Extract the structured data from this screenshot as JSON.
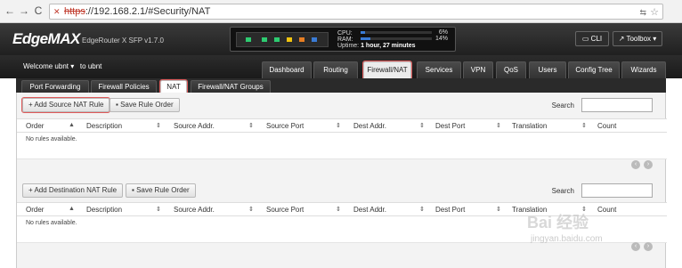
{
  "browser": {
    "back": "←",
    "forward": "→",
    "reload": "C",
    "url_prefix": "https",
    "url_rest": "://192.168.2.1/#Security/NAT"
  },
  "header": {
    "logo": "EdgeMAX",
    "model": "EdgeRouter X SFP v1.7.0",
    "cpu_label": "CPU:",
    "cpu_value": "6%",
    "ram_label": "RAM:",
    "ram_value": "14%",
    "uptime_label": "Uptime:",
    "uptime_value": "1 hour, 27 minutes",
    "cli_label": "CLI",
    "toolbox_label": "Toolbox",
    "port_colors": [
      "#2ecc71",
      "#2ecc71",
      "#2ecc71",
      "#f1c40f",
      "#e67e22",
      "#3a7bd5"
    ]
  },
  "nav": {
    "welcome": "Welcome ubnt",
    "to": "to ubnt",
    "tabs": [
      "Dashboard",
      "Routing",
      "Firewall/NAT",
      "Services",
      "VPN",
      "QoS",
      "Users",
      "Config Tree",
      "Wizards"
    ],
    "active": "Firewall/NAT"
  },
  "subnav": {
    "tabs": [
      "Port Forwarding",
      "Firewall Policies",
      "NAT",
      "Firewall/NAT Groups"
    ],
    "active": "NAT"
  },
  "source_nat": {
    "add_label": "Add Source NAT Rule",
    "save_label": "Save Rule Order",
    "search_label": "Search",
    "columns": [
      "Order",
      "Description",
      "Source Addr.",
      "Source Port",
      "Dest Addr.",
      "Dest Port",
      "Translation",
      "Count"
    ],
    "empty": "No rules available."
  },
  "dest_nat": {
    "add_label": "Add Destination NAT Rule",
    "save_label": "Save Rule Order",
    "search_label": "Search",
    "columns": [
      "Order",
      "Description",
      "Source Addr.",
      "Source Port",
      "Dest Addr.",
      "Dest Port",
      "Translation",
      "Count"
    ],
    "empty": "No rules available."
  },
  "watermark": {
    "text": "Bai 经验",
    "sub": "jingyan.baidu.com"
  }
}
